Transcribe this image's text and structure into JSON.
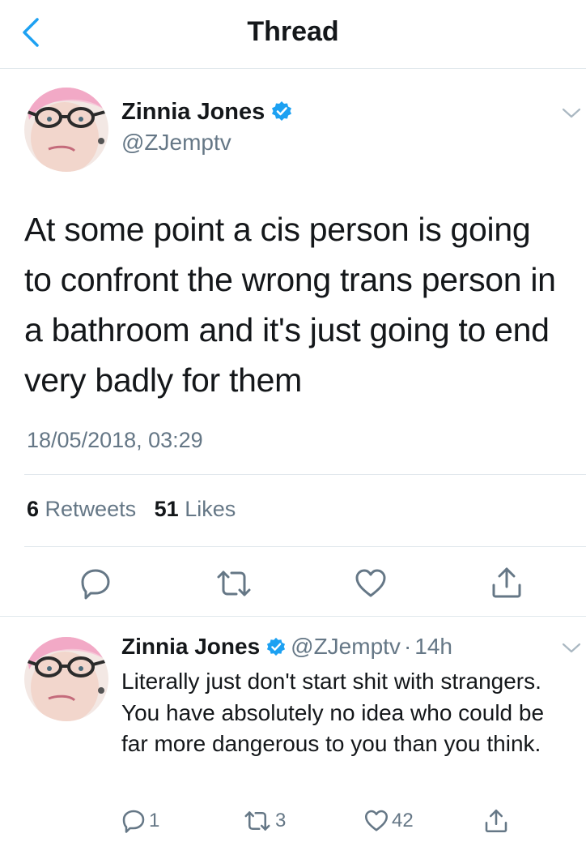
{
  "header": {
    "title": "Thread"
  },
  "tweet": {
    "name": "Zinnia Jones",
    "handle": "@ZJemptv",
    "text": "At some point a cis person is going to confront the wrong trans person in a bathroom and it's just going to end very badly for them",
    "timestamp": "18/05/2018, 03:29",
    "retweets_count": "6",
    "retweets_label": "Retweets",
    "likes_count": "51",
    "likes_label": "Likes"
  },
  "reply": {
    "name": "Zinnia Jones",
    "handle": "@ZJemptv",
    "separator": "·",
    "time": "14h",
    "text": "Literally just don't start shit with strangers. You have absolutely no idea who could be far more dangerous to you than you think.",
    "reply_count": "1",
    "retweet_count": "3",
    "like_count": "42"
  },
  "colors": {
    "accent": "#1da1f2",
    "verified": "#1da1f2",
    "secondary_text": "#657786",
    "divider": "#e1e8ed"
  },
  "icons": [
    "chevron-left-icon",
    "verified-badge-icon",
    "chevron-down-icon",
    "reply-icon",
    "retweet-icon",
    "like-icon",
    "share-icon"
  ]
}
